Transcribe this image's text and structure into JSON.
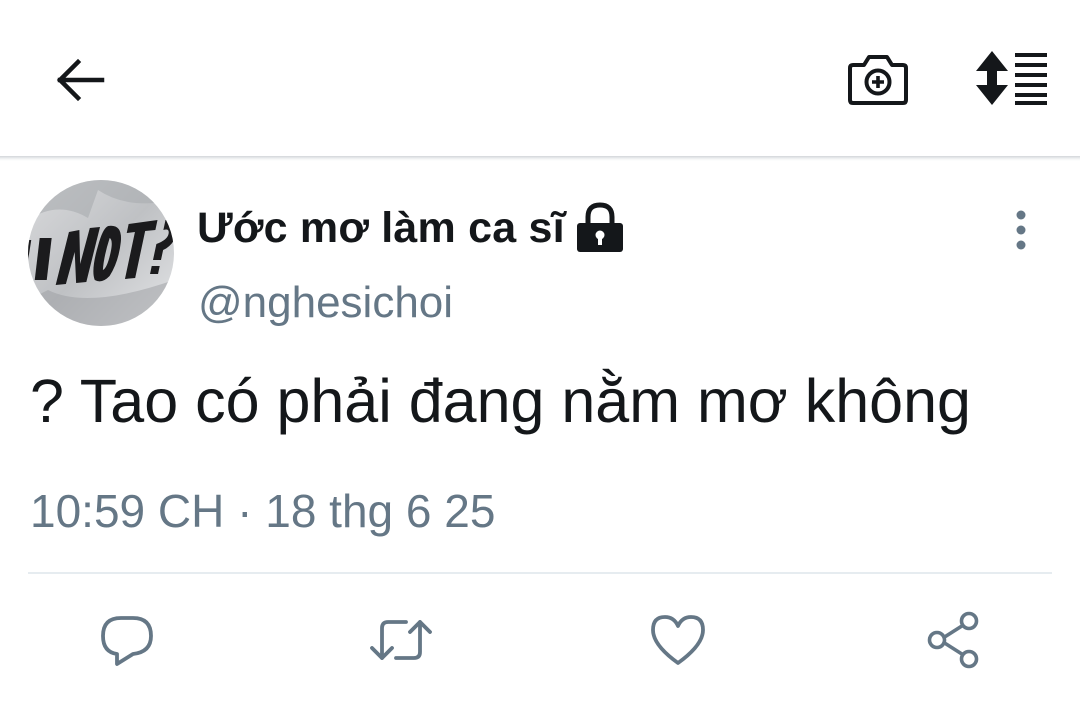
{
  "header": {
    "back_icon": "arrow-left-icon",
    "camera_icon": "camera-plus-icon",
    "sort_icon": "sort-list-icon"
  },
  "tweet": {
    "display_name": "Ước mơ làm ca sĩ",
    "protected_icon": "lock-icon",
    "handle": "@nghesichoi",
    "text": "? Tao có phải đang nằm mơ không",
    "time": "10:59 CH",
    "separator": "·",
    "date": "18 thg 6 25",
    "more_icon": "more-vertical-icon"
  },
  "actions": {
    "reply_icon": "reply-icon",
    "retweet_icon": "retweet-icon",
    "like_icon": "heart-icon",
    "share_icon": "share-icon"
  },
  "colors": {
    "primary_text": "#14171a",
    "secondary_text": "#657786",
    "divider": "#e6ecf0"
  }
}
